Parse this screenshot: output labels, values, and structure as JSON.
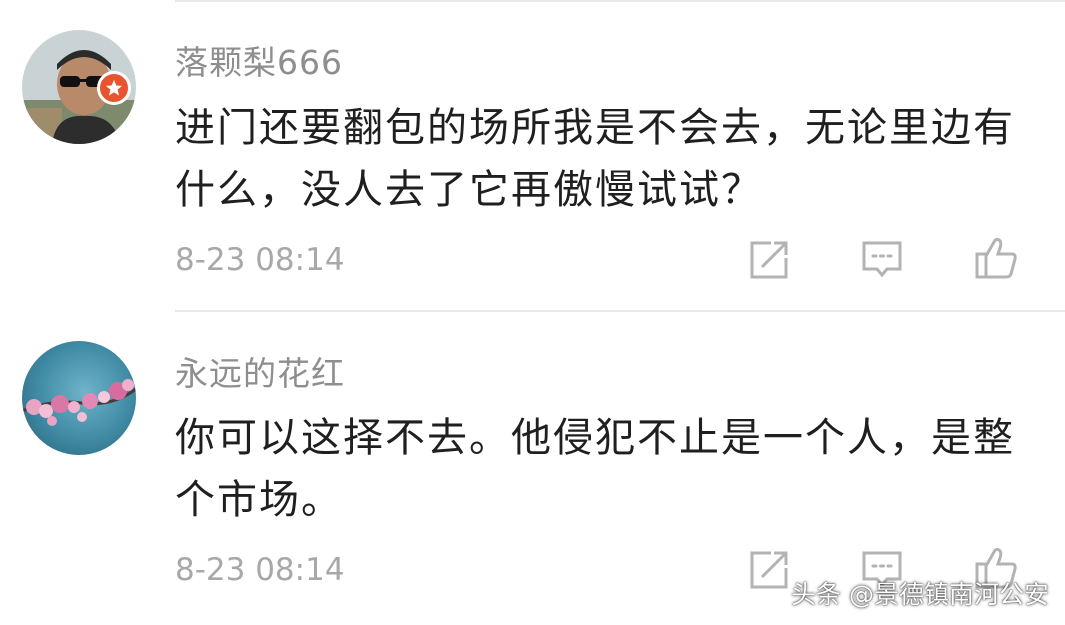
{
  "comments": [
    {
      "username": "落颗梨666",
      "text": "进门还要翻包的场所我是不会去，无论里边有什么，没人去了它再傲慢试试？",
      "time": "8-23 08:14"
    },
    {
      "username": "永远的花红",
      "text": "你可以这择不去。他侵犯不止是一个人，是整个市场。",
      "time": "8-23 08:14"
    }
  ],
  "icons": {
    "repost": "repost-icon",
    "comment": "comment-icon",
    "like": "like-icon",
    "verified": "verified-badge-icon"
  },
  "colors": {
    "username": "#8e8e8e",
    "text": "#1f1f1f",
    "time": "#a8a8a8",
    "icon": "#b3b3b3",
    "badge": "#e8542f",
    "divider": "#e9e9e9"
  },
  "watermark": "头条 @景德镇南河公安"
}
